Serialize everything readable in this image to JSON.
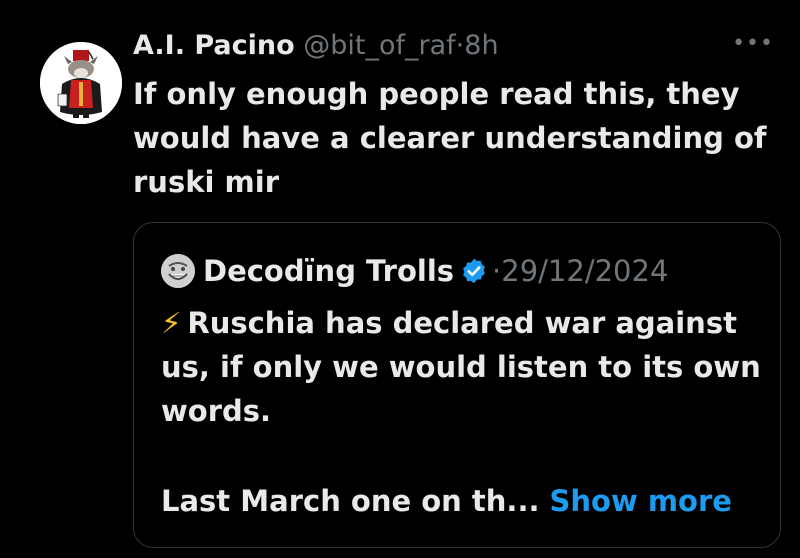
{
  "tweet": {
    "display_name": "A.I. Pacino",
    "handle": "@bit_of_raf",
    "separator": "·",
    "time": "8h",
    "more_icon": "more-horizontal-icon",
    "text": "If only enough people read this, they would have a clearer understanding of ruski mir"
  },
  "quote": {
    "display_name": "Decodïng Trolls",
    "verified": true,
    "separator": "·",
    "date": "29/12/2024",
    "bolt": "⚡",
    "text": "Ruschia has declared war against us, if only we would listen to its own words.",
    "truncated_text": "Last March one on th...",
    "show_more_label": "Show more"
  },
  "colors": {
    "background": "#000000",
    "primary_text": "#e7e9ea",
    "secondary_text": "#71767b",
    "link": "#1d9bf0",
    "verified": "#1d9bf0",
    "border": "#2f3336"
  }
}
